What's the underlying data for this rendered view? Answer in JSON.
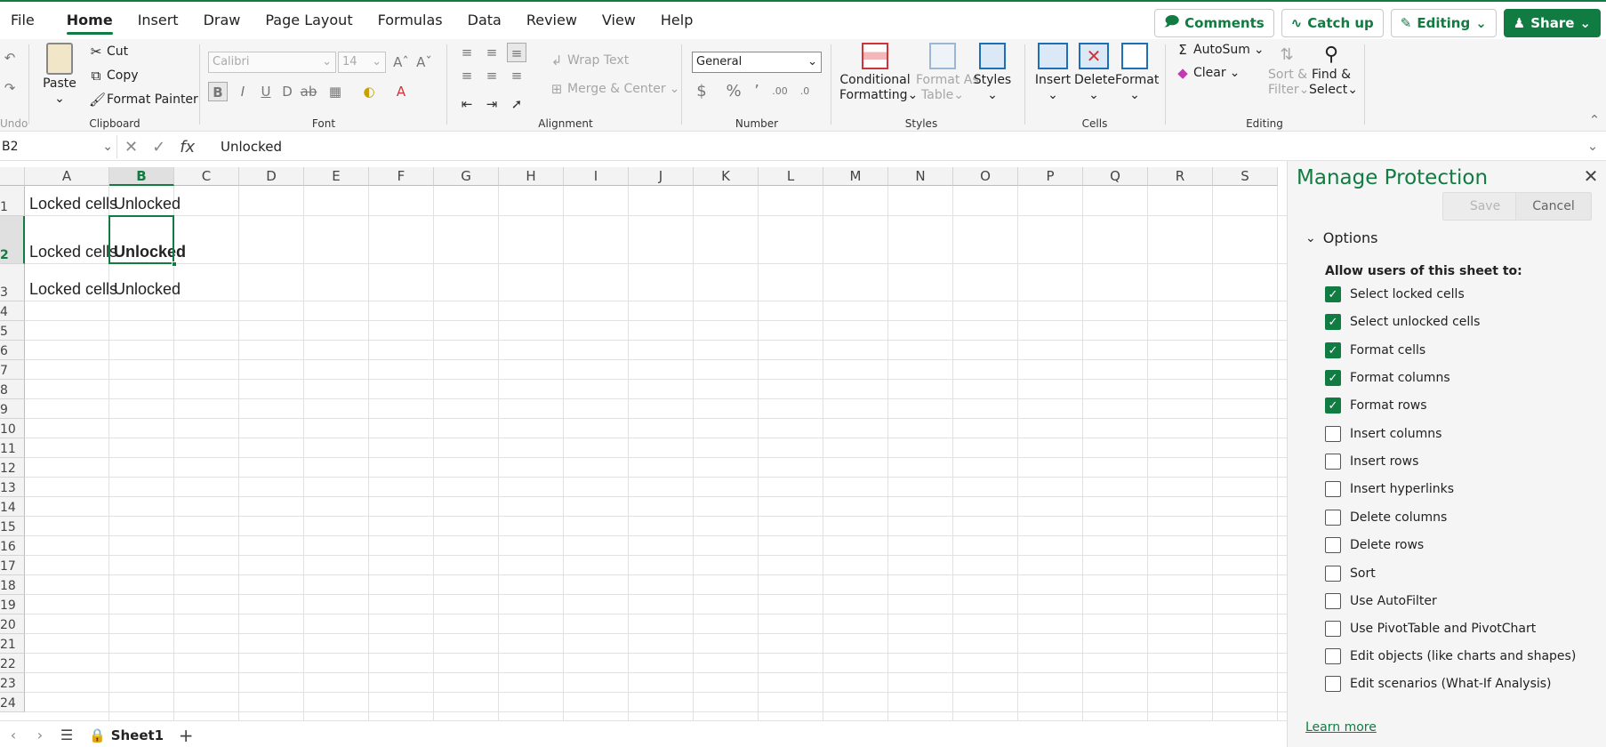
{
  "menu": {
    "tabs": [
      "File",
      "Home",
      "Insert",
      "Draw",
      "Page Layout",
      "Formulas",
      "Data",
      "Review",
      "View",
      "Help"
    ],
    "active": "Home",
    "comments": "Comments",
    "catchup": "Catch up",
    "editing": "Editing",
    "share": "Share"
  },
  "ribbon": {
    "undo_label": "Undo",
    "clipboard": {
      "label": "Clipboard",
      "paste": "Paste",
      "cut": "Cut",
      "copy": "Copy",
      "format_painter": "Format Painter"
    },
    "font": {
      "label": "Font",
      "font_name": "Calibri",
      "font_size": "14"
    },
    "alignment": {
      "label": "Alignment",
      "wrap": "Wrap Text",
      "merge": "Merge & Center"
    },
    "number": {
      "label": "Number",
      "format": "General"
    },
    "styles": {
      "label": "Styles",
      "conditional": "Conditional",
      "conditional2": "Formatting",
      "format_as": "Format As",
      "format_as2": "Table",
      "styles": "Styles"
    },
    "cells": {
      "label": "Cells",
      "insert": "Insert",
      "delete": "Delete",
      "format": "Format"
    },
    "editing": {
      "label": "Editing",
      "autosum": "AutoSum",
      "clear": "Clear",
      "sort": "Sort &",
      "sort2": "Filter",
      "find": "Find &",
      "find2": "Select"
    }
  },
  "formula_bar": {
    "name_box": "B2",
    "value": "Unlocked"
  },
  "grid": {
    "columns": [
      "A",
      "B",
      "C",
      "D",
      "E",
      "F",
      "G",
      "H",
      "I",
      "J",
      "K",
      "L",
      "M",
      "N",
      "O",
      "P",
      "Q",
      "R",
      "S"
    ],
    "rows": [
      "1",
      "2",
      "3",
      "4",
      "5",
      "6",
      "7",
      "8",
      "9",
      "10",
      "11",
      "12",
      "13",
      "14",
      "15",
      "16",
      "17",
      "18",
      "19",
      "20",
      "21",
      "22",
      "23",
      "24"
    ],
    "cells": {
      "A1": "Locked cells",
      "B1": "Unlocked",
      "A2": "Locked cells",
      "B2": "Unlocked",
      "A3": "Locked cells",
      "B3": "Unlocked"
    },
    "selected": "B2"
  },
  "sheets": {
    "name": "Sheet1"
  },
  "pane": {
    "title": "Manage Protection",
    "save": "Save",
    "cancel": "Cancel",
    "options": "Options",
    "allow_label": "Allow users of this sheet to:",
    "options_list": [
      {
        "label": "Select locked cells",
        "checked": true
      },
      {
        "label": "Select unlocked cells",
        "checked": true
      },
      {
        "label": "Format cells",
        "checked": true
      },
      {
        "label": "Format columns",
        "checked": true
      },
      {
        "label": "Format rows",
        "checked": true
      },
      {
        "label": "Insert columns",
        "checked": false
      },
      {
        "label": "Insert rows",
        "checked": false
      },
      {
        "label": "Insert hyperlinks",
        "checked": false
      },
      {
        "label": "Delete columns",
        "checked": false
      },
      {
        "label": "Delete rows",
        "checked": false
      },
      {
        "label": "Sort",
        "checked": false
      },
      {
        "label": "Use AutoFilter",
        "checked": false
      },
      {
        "label": "Use PivotTable and PivotChart",
        "checked": false
      },
      {
        "label": "Edit objects (like charts and shapes)",
        "checked": false
      },
      {
        "label": "Edit scenarios (What-If Analysis)",
        "checked": false
      }
    ],
    "learn_more": "Learn more"
  },
  "colors": {
    "accent": "#107c41"
  }
}
